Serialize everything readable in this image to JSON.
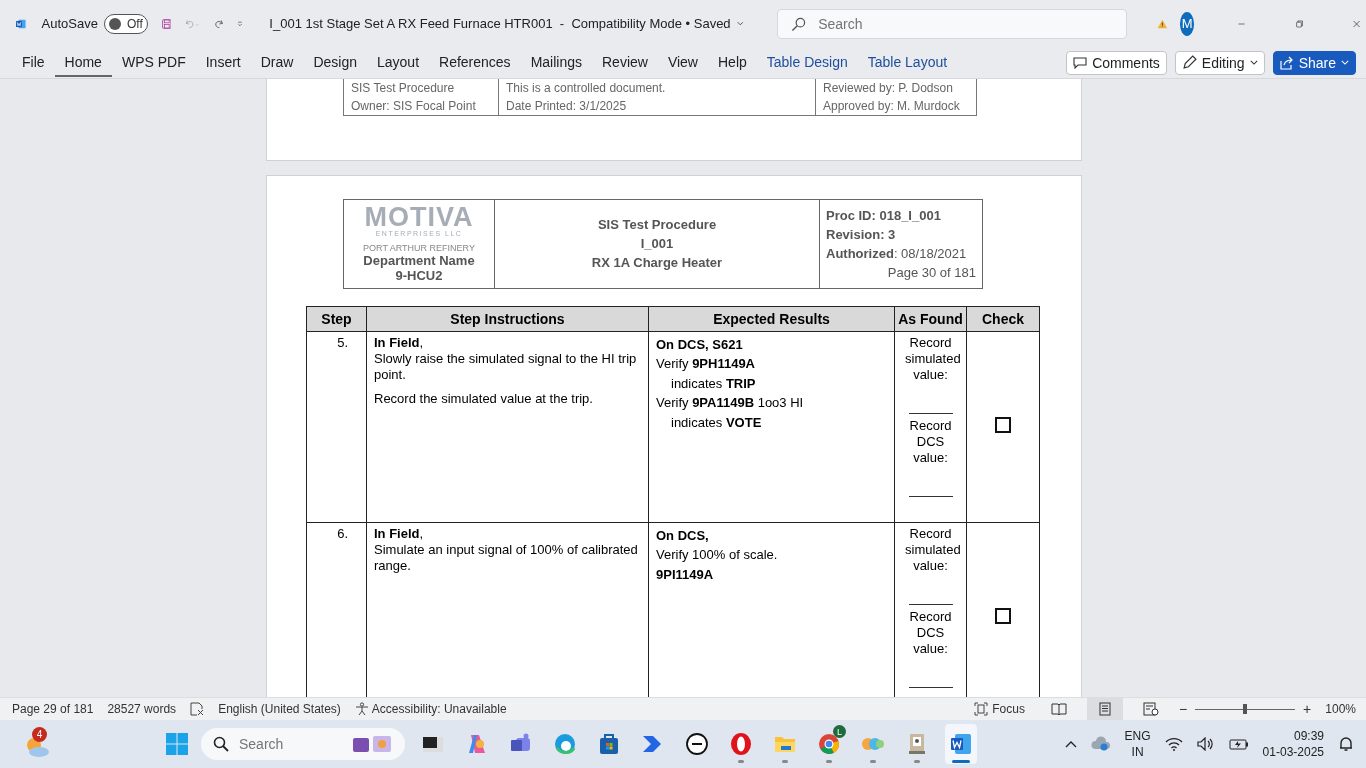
{
  "title_bar": {
    "autosave": {
      "label": "AutoSave",
      "on": false,
      "state_label": "Off"
    },
    "document_title": "I_001 1st Stage Set A RX Feed Furnace HTR001",
    "separator": "-",
    "mode": "Compatibility Mode",
    "save_dot": "•",
    "save_state": "Saved",
    "search_placeholder": "Search",
    "avatar": "M"
  },
  "ribbon_tabs": [
    {
      "label": "File",
      "selected": false,
      "kind": "normal"
    },
    {
      "label": "Home",
      "selected": true,
      "kind": "normal"
    },
    {
      "label": "WPS PDF",
      "selected": false,
      "kind": "normal"
    },
    {
      "label": "Insert",
      "selected": false,
      "kind": "normal"
    },
    {
      "label": "Draw",
      "selected": false,
      "kind": "normal"
    },
    {
      "label": "Design",
      "selected": false,
      "kind": "normal"
    },
    {
      "label": "Layout",
      "selected": false,
      "kind": "normal"
    },
    {
      "label": "References",
      "selected": false,
      "kind": "normal"
    },
    {
      "label": "Mailings",
      "selected": false,
      "kind": "normal"
    },
    {
      "label": "Review",
      "selected": false,
      "kind": "normal"
    },
    {
      "label": "View",
      "selected": false,
      "kind": "normal"
    },
    {
      "label": "Help",
      "selected": false,
      "kind": "normal"
    },
    {
      "label": "Table Design",
      "selected": false,
      "kind": "contextual"
    },
    {
      "label": "Table Layout",
      "selected": false,
      "kind": "contextual"
    }
  ],
  "ribbon_actions": {
    "comments": "Comments",
    "editing": "Editing",
    "share": "Share"
  },
  "previous_page_footer": [
    [
      "SIS Test Procedure",
      "This is a controlled document.",
      "Reviewed by: P. Dodson"
    ],
    [
      "Owner: SIS Focal Point",
      "Date Printed: 3/1/2025",
      "Approved by: M. Murdock"
    ]
  ],
  "page_header": {
    "logo": "MOTIVA",
    "logo_subtitle": "ENTERPRISES LLC",
    "refinery": "PORT ARTHUR REFINERY",
    "department": "Department Name",
    "unit": "9-HCU2",
    "title_lines": [
      "SIS Test Procedure",
      "I_001",
      "RX 1A Charge Heater"
    ],
    "info_lines": [
      "**Proc ID: 018_I_001**",
      "**Revision: 3**",
      "**Authorized**: 08/18/2021"
    ],
    "page": "Page 30 of 181"
  },
  "table": {
    "columns": [
      "Step",
      "Step Instructions",
      "Expected Results",
      "As Found",
      "Check"
    ],
    "rows": [
      {
        "step": "5.",
        "instructions": [
          "**In Field**,\nSlowly raise the simulated signal to the HI trip point.",
          "Record the simulated value at the trip."
        ],
        "expected": [
          {
            "text": "**On DCS, S621**",
            "indent": false
          },
          {
            "text": "Verify **9PH1149A**",
            "indent": false
          },
          {
            "text": "indicates **TRIP**",
            "indent": true
          },
          {
            "text": "Verify **9PA1149B** 1oo3 HI",
            "indent": false
          },
          {
            "text": "indicates **VOTE**",
            "indent": true
          }
        ],
        "as_found": [
          "Record simulated value:",
          "Record DCS value:"
        ],
        "checked": false
      },
      {
        "step": "6.",
        "instructions": [
          "**In Field**,\nSimulate an input signal of 100% of calibrated range."
        ],
        "expected": [
          {
            "text": "**On DCS,**",
            "indent": false
          },
          {
            "text": "Verify 100% of scale.",
            "indent": false
          },
          {
            "text": "**9PI1149A**",
            "indent": false
          }
        ],
        "as_found": [
          "Record simulated value:",
          "Record DCS value:"
        ],
        "checked": false
      }
    ]
  },
  "status_bar": {
    "page": "Page 29 of 181",
    "words": "28527 words",
    "language": "English (United States)",
    "accessibility": "Accessibility: Unavailable",
    "focus": "Focus",
    "zoom_out": "−",
    "zoom_in": "+",
    "zoom": "100%",
    "zoom_level": {
      "level": 0.5
    }
  },
  "taskbar": {
    "widget_badge": "4",
    "search_placeholder": "Search",
    "apps": [
      {
        "kind": "dark-window",
        "running": false,
        "selected": false
      },
      {
        "kind": "copilot",
        "running": false,
        "selected": false
      },
      {
        "kind": "teams",
        "running": false,
        "selected": false
      },
      {
        "kind": "edge",
        "running": false,
        "selected": false
      },
      {
        "kind": "store",
        "running": false,
        "selected": false
      },
      {
        "kind": "automate",
        "running": false,
        "selected": false
      },
      {
        "kind": "dell",
        "running": false,
        "selected": false
      },
      {
        "kind": "opera",
        "running": true,
        "selected": false
      },
      {
        "kind": "explorer",
        "running": true,
        "selected": false
      },
      {
        "kind": "chrome",
        "running": true,
        "selected": false,
        "badge": "L"
      },
      {
        "kind": "blobs",
        "running": true,
        "selected": false
      },
      {
        "kind": "viewer",
        "running": true,
        "selected": false
      },
      {
        "kind": "word",
        "running": true,
        "selected": true
      }
    ],
    "language": [
      "ENG",
      "IN"
    ],
    "time": "09:39",
    "date": "01-03-2025"
  }
}
